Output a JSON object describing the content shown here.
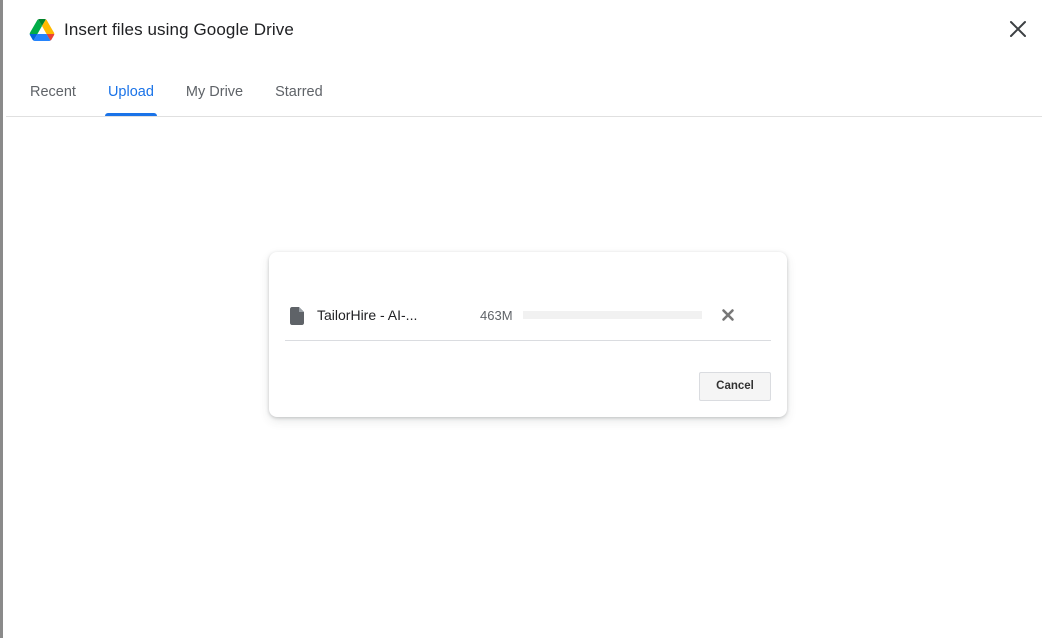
{
  "dialog": {
    "title": "Insert files using Google Drive",
    "logo_icon": "google-drive-logo",
    "close_icon": "close-icon"
  },
  "tabs": [
    {
      "label": "Recent",
      "active": false
    },
    {
      "label": "Upload",
      "active": true
    },
    {
      "label": "My Drive",
      "active": false
    },
    {
      "label": "Starred",
      "active": false
    }
  ],
  "upload": {
    "file": {
      "icon": "file-icon",
      "name": "TailorHire - AI-...",
      "size": "463M",
      "progress": 0
    },
    "remove_icon": "remove-file-icon",
    "cancel_label": "Cancel"
  },
  "colors": {
    "accent": "#1a73e8",
    "tab_inactive": "#5f6368",
    "text_primary": "#202124",
    "divider": "#e0e0e0",
    "progress_track": "#f1f1f1"
  }
}
